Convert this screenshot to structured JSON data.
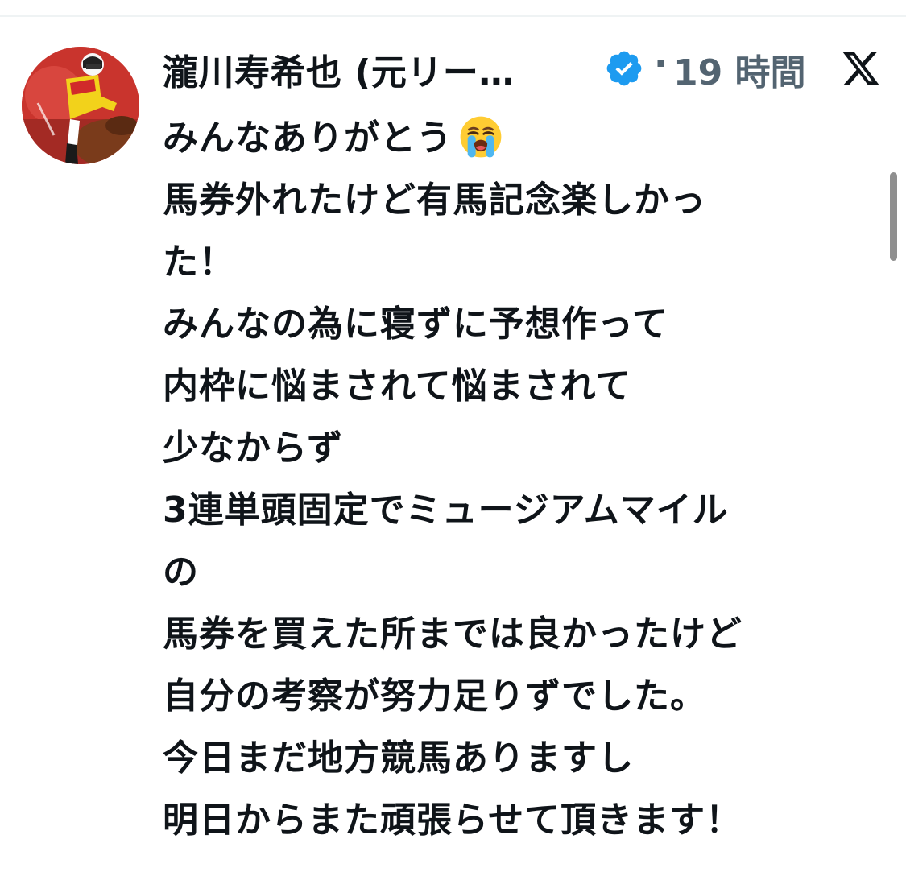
{
  "post": {
    "author_name": "瀧川寿希也 (元リー…",
    "separator": "·",
    "timestamp": "19 時間",
    "platform_icon": "x-logo-icon",
    "verified_icon": "verified-badge-icon",
    "avatar_icon": "jockey-avatar",
    "lines": [
      "みんなありがとう",
      "馬券外れたけど有馬記念楽しかっ",
      "た！",
      "みんなの為に寝ずに予想作って",
      "内枠に悩まされて悩まされて",
      "少なからず",
      "3連単頭固定でミュージアムマイル",
      "の",
      "馬券を買えた所までは良かったけど",
      "自分の考察が努力足りずでした。",
      "今日まだ地方競馬ありますし",
      "明日からまた頑張らせて頂きます！"
    ],
    "emoji": "loudly-crying-face-icon"
  },
  "colors": {
    "text": "#0f1419",
    "secondary": "#536471",
    "verified": "#1d9bf0",
    "divider": "#eff3f4"
  }
}
